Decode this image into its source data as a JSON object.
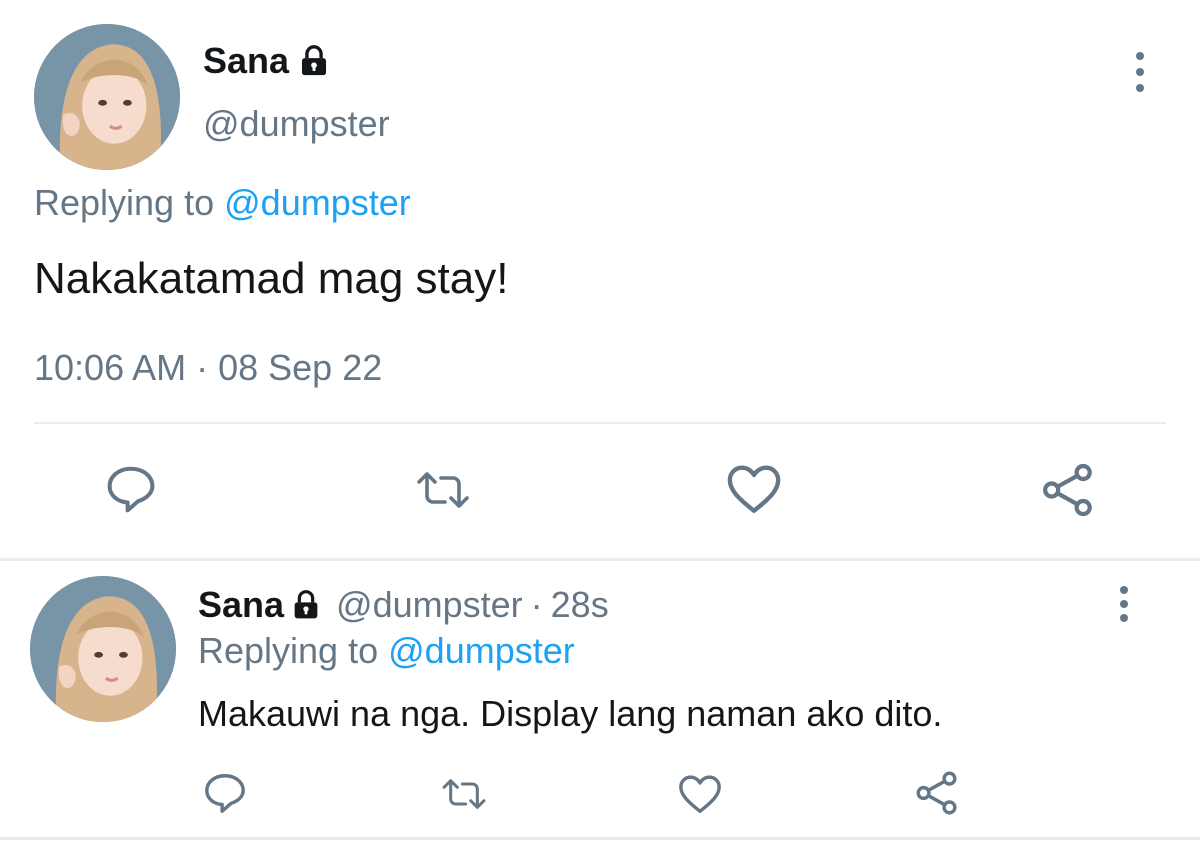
{
  "main_tweet": {
    "display_name": "Sana",
    "handle": "@dumpster",
    "replying_prefix": "Replying to",
    "replying_mention": "@dumpster",
    "text": "Nakakatamad mag stay!",
    "timestamp": "10:06 AM · 08 Sep 22",
    "actions": [
      "reply-icon",
      "retweet-icon",
      "like-icon",
      "share-icon"
    ]
  },
  "reply_tweet": {
    "display_name": "Sana",
    "handle": "@dumpster",
    "separator": "·",
    "time_ago": "28s",
    "replying_prefix": "Replying to",
    "replying_mention": "@dumpster",
    "text": "Makauwi na nga. Display lang naman ako dito.",
    "actions": [
      "reply-icon",
      "retweet-icon",
      "like-icon",
      "share-icon"
    ]
  },
  "colors": {
    "text": "#14171a",
    "secondary": "#657786",
    "link": "#1da1f2",
    "divider": "#e6ecf0"
  }
}
